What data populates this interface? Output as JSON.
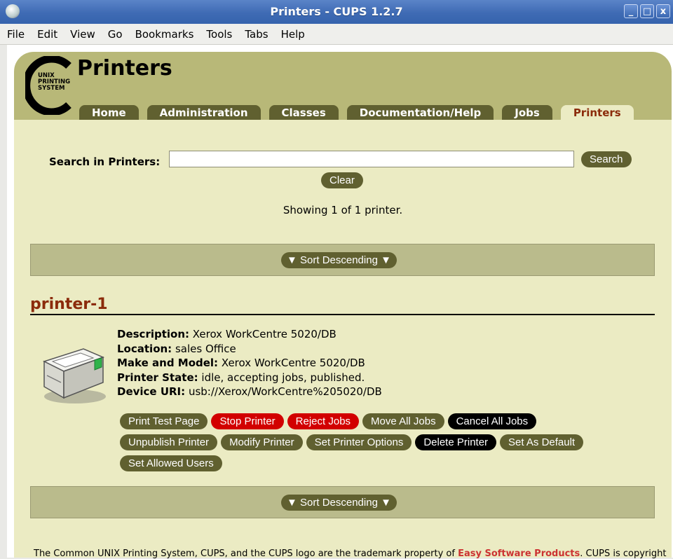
{
  "window": {
    "title": "Printers - CUPS 1.2.7",
    "buttons": [
      "_",
      "□",
      "x"
    ]
  },
  "menu": [
    {
      "label": "File"
    },
    {
      "label": "Edit"
    },
    {
      "label": "View"
    },
    {
      "label": "Go"
    },
    {
      "label": "Bookmarks"
    },
    {
      "label": "Tools"
    },
    {
      "label": "Tabs"
    },
    {
      "label": "Help"
    }
  ],
  "logo": {
    "line1": "UNIX",
    "line2": "PRINTING",
    "line3": "SYSTEM"
  },
  "header": {
    "title": "Printers"
  },
  "tabs": [
    {
      "label": "Home"
    },
    {
      "label": "Administration"
    },
    {
      "label": "Classes"
    },
    {
      "label": "Documentation/Help"
    },
    {
      "label": "Jobs"
    },
    {
      "label": "Printers",
      "active": true
    }
  ],
  "search": {
    "label": "Search in Printers:",
    "value": "",
    "search_button": "Search",
    "clear_button": "Clear"
  },
  "showing_text": "Showing 1 of 1 printer.",
  "sort_label": "▼ Sort Descending ▼",
  "printer": {
    "name": "printer-1",
    "details": [
      {
        "label": "Description:",
        "value": "Xerox WorkCentre 5020/DB"
      },
      {
        "label": "Location:",
        "value": "sales Office"
      },
      {
        "label": "Make and Model:",
        "value": "Xerox WorkCentre 5020/DB"
      },
      {
        "label": "Printer State:",
        "value": "idle, accepting jobs, published."
      },
      {
        "label": "Device URI:",
        "value": "usb://Xerox/WorkCentre%205020/DB"
      }
    ],
    "actions": [
      {
        "label": "Print Test Page",
        "style": "olive"
      },
      {
        "label": "Stop Printer",
        "style": "red"
      },
      {
        "label": "Reject Jobs",
        "style": "red"
      },
      {
        "label": "Move All Jobs",
        "style": "olive"
      },
      {
        "label": "Cancel All Jobs",
        "style": "black"
      },
      {
        "label": "Unpublish Printer",
        "style": "olive"
      },
      {
        "label": "Modify Printer",
        "style": "olive"
      },
      {
        "label": "Set Printer Options",
        "style": "olive"
      },
      {
        "label": "Delete Printer",
        "style": "black"
      },
      {
        "label": "Set As Default",
        "style": "olive"
      },
      {
        "label": "Set Allowed Users",
        "style": "olive"
      }
    ]
  },
  "footer": {
    "text_before": "The Common UNIX Printing System, CUPS, and the CUPS logo are the trademark property of ",
    "link": "Easy Software Products",
    "text_after": ". CUPS is copyright"
  }
}
